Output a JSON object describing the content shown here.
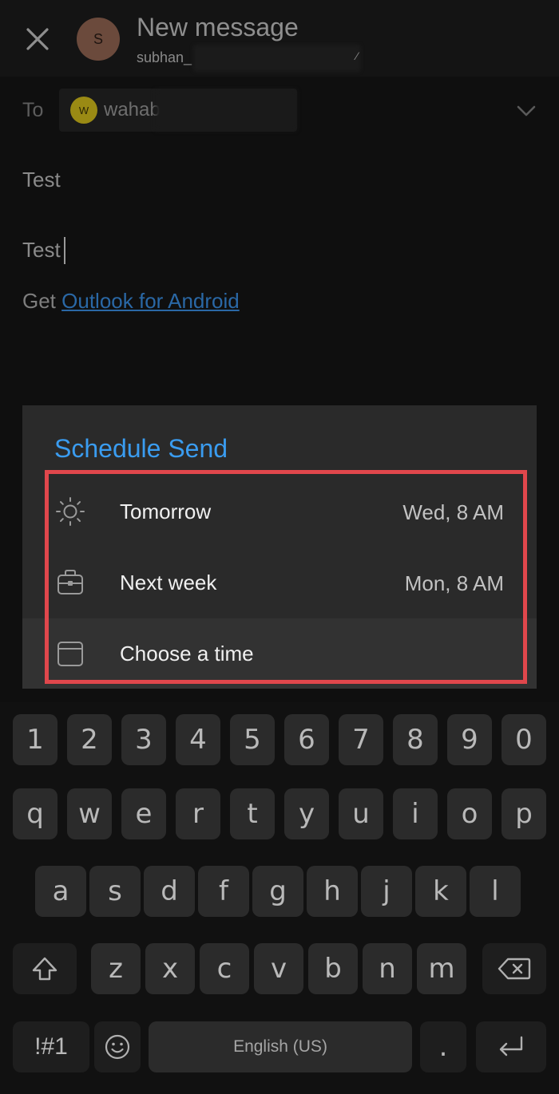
{
  "app_bar": {
    "title": "New message",
    "account": "subhan_",
    "sender_initial": "S"
  },
  "compose": {
    "to_label": "To",
    "recipient_initial": "W",
    "recipient_name": "wahab",
    "subject": "Test",
    "body": "Test",
    "signature_prefix": "Get ",
    "signature_link": "Outlook for Android"
  },
  "schedule_dialog": {
    "title": "Schedule Send",
    "options": [
      {
        "label": "Tomorrow",
        "time": "Wed, 8 AM",
        "icon": "sun-icon"
      },
      {
        "label": "Next week",
        "time": "Mon, 8 AM",
        "icon": "briefcase-icon"
      },
      {
        "label": "Choose a time",
        "time": "",
        "icon": "calendar-icon"
      }
    ],
    "highlight_color": "#e0474c",
    "accent_color": "#3a9cf0"
  },
  "keyboard": {
    "row_numbers": [
      "1",
      "2",
      "3",
      "4",
      "5",
      "6",
      "7",
      "8",
      "9",
      "0"
    ],
    "row_top": [
      "q",
      "w",
      "e",
      "r",
      "t",
      "y",
      "u",
      "i",
      "o",
      "p"
    ],
    "row_middle": [
      "a",
      "s",
      "d",
      "f",
      "g",
      "h",
      "j",
      "k",
      "l"
    ],
    "row_bottom": [
      "z",
      "x",
      "c",
      "v",
      "b",
      "n",
      "m"
    ],
    "symbols_label": "!#1",
    "space_label": "English (US)",
    "period_label": "."
  }
}
